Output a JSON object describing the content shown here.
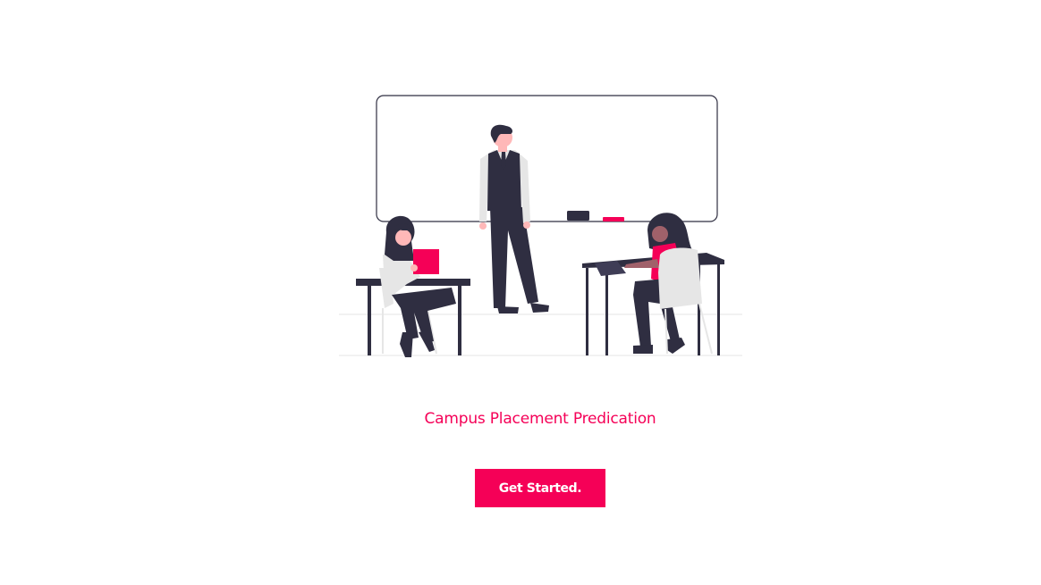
{
  "hero": {
    "illustration": "classroom-presentation-illustration",
    "title": "Campus Placement Predication"
  },
  "actions": {
    "get_started_label": "Get Started."
  },
  "colors": {
    "accent": "#f50057",
    "dark": "#2f2e41",
    "light_gray": "#e6e6e6",
    "background": "#ffffff"
  }
}
